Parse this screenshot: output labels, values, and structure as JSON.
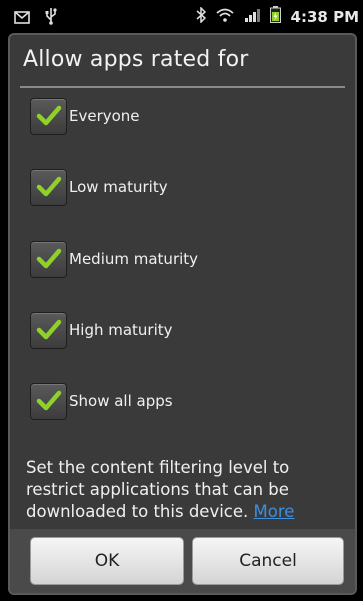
{
  "status_bar": {
    "time": "4:38 PM",
    "icons": [
      "email-icon",
      "usb-icon",
      "bluetooth-icon",
      "wifi-icon",
      "signal-icon",
      "battery-icon"
    ]
  },
  "dialog": {
    "title": "Allow apps rated for",
    "options": [
      {
        "label": "Everyone",
        "checked": true
      },
      {
        "label": "Low maturity",
        "checked": true
      },
      {
        "label": "Medium maturity",
        "checked": true
      },
      {
        "label": "High maturity",
        "checked": true
      },
      {
        "label": "Show all apps",
        "checked": true
      }
    ],
    "description": "Set the content filtering level to restrict applications that can be downloaded to this device.",
    "more_link": "More",
    "ok_label": "OK",
    "cancel_label": "Cancel"
  },
  "colors": {
    "check": "#8fd12a",
    "link": "#3d8fe0",
    "dialog_bg": "#3a3a3a"
  }
}
